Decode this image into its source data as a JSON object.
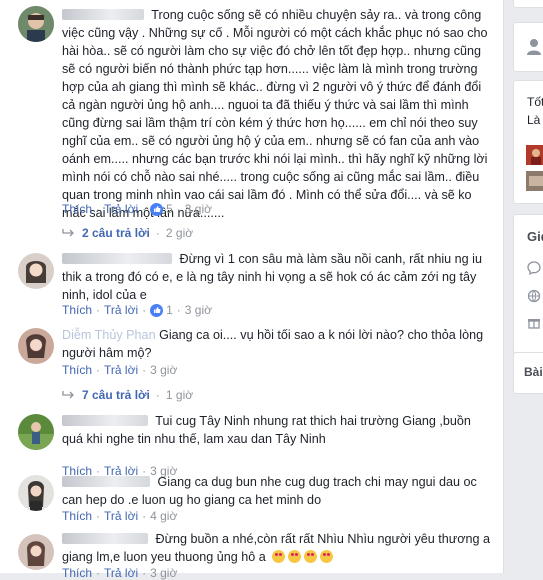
{
  "comments": [
    {
      "text": "Trong cuộc sống sẽ có nhiều chuyện sảy ra.. và trong công việc cũng vậy . Những sự cố . Mỗi người có một cách khắc phục nó sao cho hài hòa.. sẽ có người làm cho sự việc đó chở lên tốt đẹp hợp.. nhưng cũng sẽ có người biến nó thành phức tạp hơn...... việc làm là mình trong trường hợp của ah giang thì mình sẽ khác.. đừng vì 2 người vô ý thức để đánh đổi cả ngàn người ủng hộ anh.... nguoi ta đã thiếu ý thức và sai lầm thì mình cũng đừng sai lầm thậm trí còn kém ý thức hơn họ...... em chỉ nói theo suy nghĩ của em.. sẽ có người ủng hộ ý của em.. nhưng sẽ có fan của anh vào oánh em..... nhưng các bạn trước khi nói lại mình.. thì hãy nghĩ kỹ những lời mình nói có chỗ nào sai nhé..... trong cuộc sống ai cũng mắc sai lầm.. điều quan trong minh nhìn vao cái sai lầm đó . Mình có thể sửa đổi.... và sẽ ko mắc sai lầm một lần nữa.......",
      "like": "Thích",
      "reply": "Trả lời",
      "reactions": "5",
      "time": "3 giờ",
      "replies_label": "2 câu trả lời",
      "replies_time": "2 giờ"
    },
    {
      "text": "Đừng vì 1 con sâu mà làm sầu nồi canh, rất nhiu ng iu thik a trong đó có e, e là ng tây ninh hi vọng a sẽ hok có ác cảm zới ng tây ninh, idol của e",
      "like": "Thích",
      "reply": "Trả lời",
      "reactions": "1",
      "time": "3 giờ"
    },
    {
      "name": "Diễm Thủy Phan",
      "text": "Giang ca oi.... vụ hồi tối sao a k nói lời nào? cho thỏa lòng người hâm mộ?",
      "like": "Thích",
      "reply": "Trả lời",
      "time": "3 giờ",
      "replies_label": "7 câu trả lời",
      "replies_time": "1 giờ"
    },
    {
      "text": "Tui cug Tây Ninh nhung rat thich hai trường Giang ,buồn quá khi nghe tin nhu thế, lam xau dan Tây Ninh",
      "like": "Thích",
      "reply": "Trả lời",
      "time": "3 giờ"
    },
    {
      "text": "Giang ca dug bun nhe cug dug trach chi may ngui dau oc can hep do .e luon ug ho giang ca het minh do",
      "like": "Thích",
      "reply": "Trả lời",
      "time": "4 giờ"
    },
    {
      "text": "Đừng buồn a nhé,còn rất rất Nhìu Nhìu người yêu thương a giang lm,e luon yeu thuong ủng hô a",
      "like": "Thích",
      "reply": "Trả lời",
      "time": "3 giờ"
    }
  ],
  "sidebar": {
    "label1": "Tốt",
    "label2": "Là",
    "label3": "Gid",
    "label4": "Bài"
  },
  "colors": {
    "link": "#4267b2",
    "meta": "#90949c",
    "text": "#1d2129",
    "like": "#4a80f5"
  }
}
